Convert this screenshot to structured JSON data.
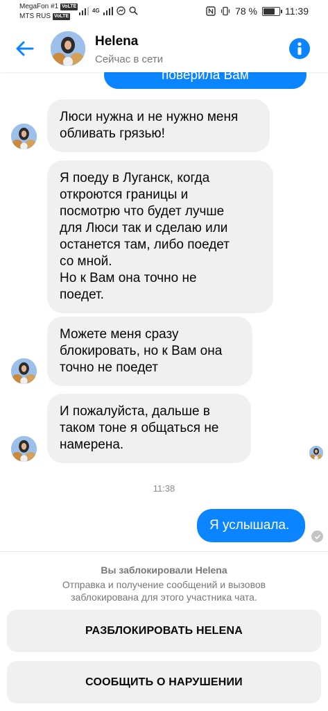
{
  "status_bar": {
    "carrier1": "MegaFon #1",
    "carrier2": "MTS RUS",
    "volte": "VoLTE",
    "network": "4G",
    "battery_text": "78 %",
    "battery_level": 0.78,
    "time": "11:39"
  },
  "header": {
    "name": "Helena",
    "status": "Сейчас в сети"
  },
  "messages": [
    {
      "direction": "out",
      "text": "поверила Вам"
    },
    {
      "direction": "in",
      "text": "Люси нужна и не нужно меня\nобливать грязью!"
    },
    {
      "direction": "in",
      "text": "Я поеду в Луганск,  когда\nоткроются границы и\nпосмотрю что будет лучше\nдля Люси так и сделаю или\nостанется там, либо поедет\nсо мной.\nНо к Вам она точно не\nпоедет."
    },
    {
      "direction": "in",
      "text": "Можете меня сразу\nблокировать, но к Вам она\nточно не поедет"
    },
    {
      "direction": "in",
      "text": "И пожалуйста, дальше в\nтаком тоне я  общаться не\nнамерена."
    },
    {
      "direction": "out",
      "text": "Я услышала."
    }
  ],
  "timestamp": "11:38",
  "block_panel": {
    "title": "Вы заблокировали Helena",
    "description": "Отправка и получение сообщений и вызовов заблокирована для этого участника чата.",
    "unblock_label": "РАЗБЛОКИРОВАТЬ HELENA",
    "report_label": "СООБЩИТЬ О НАРУШЕНИИ"
  },
  "colors": {
    "accent": "#0a84ff",
    "incoming_bubble": "#f0f0f0"
  },
  "icons": {
    "back": "back-arrow-icon",
    "info": "info-icon",
    "delivered": "check-circle-icon"
  }
}
